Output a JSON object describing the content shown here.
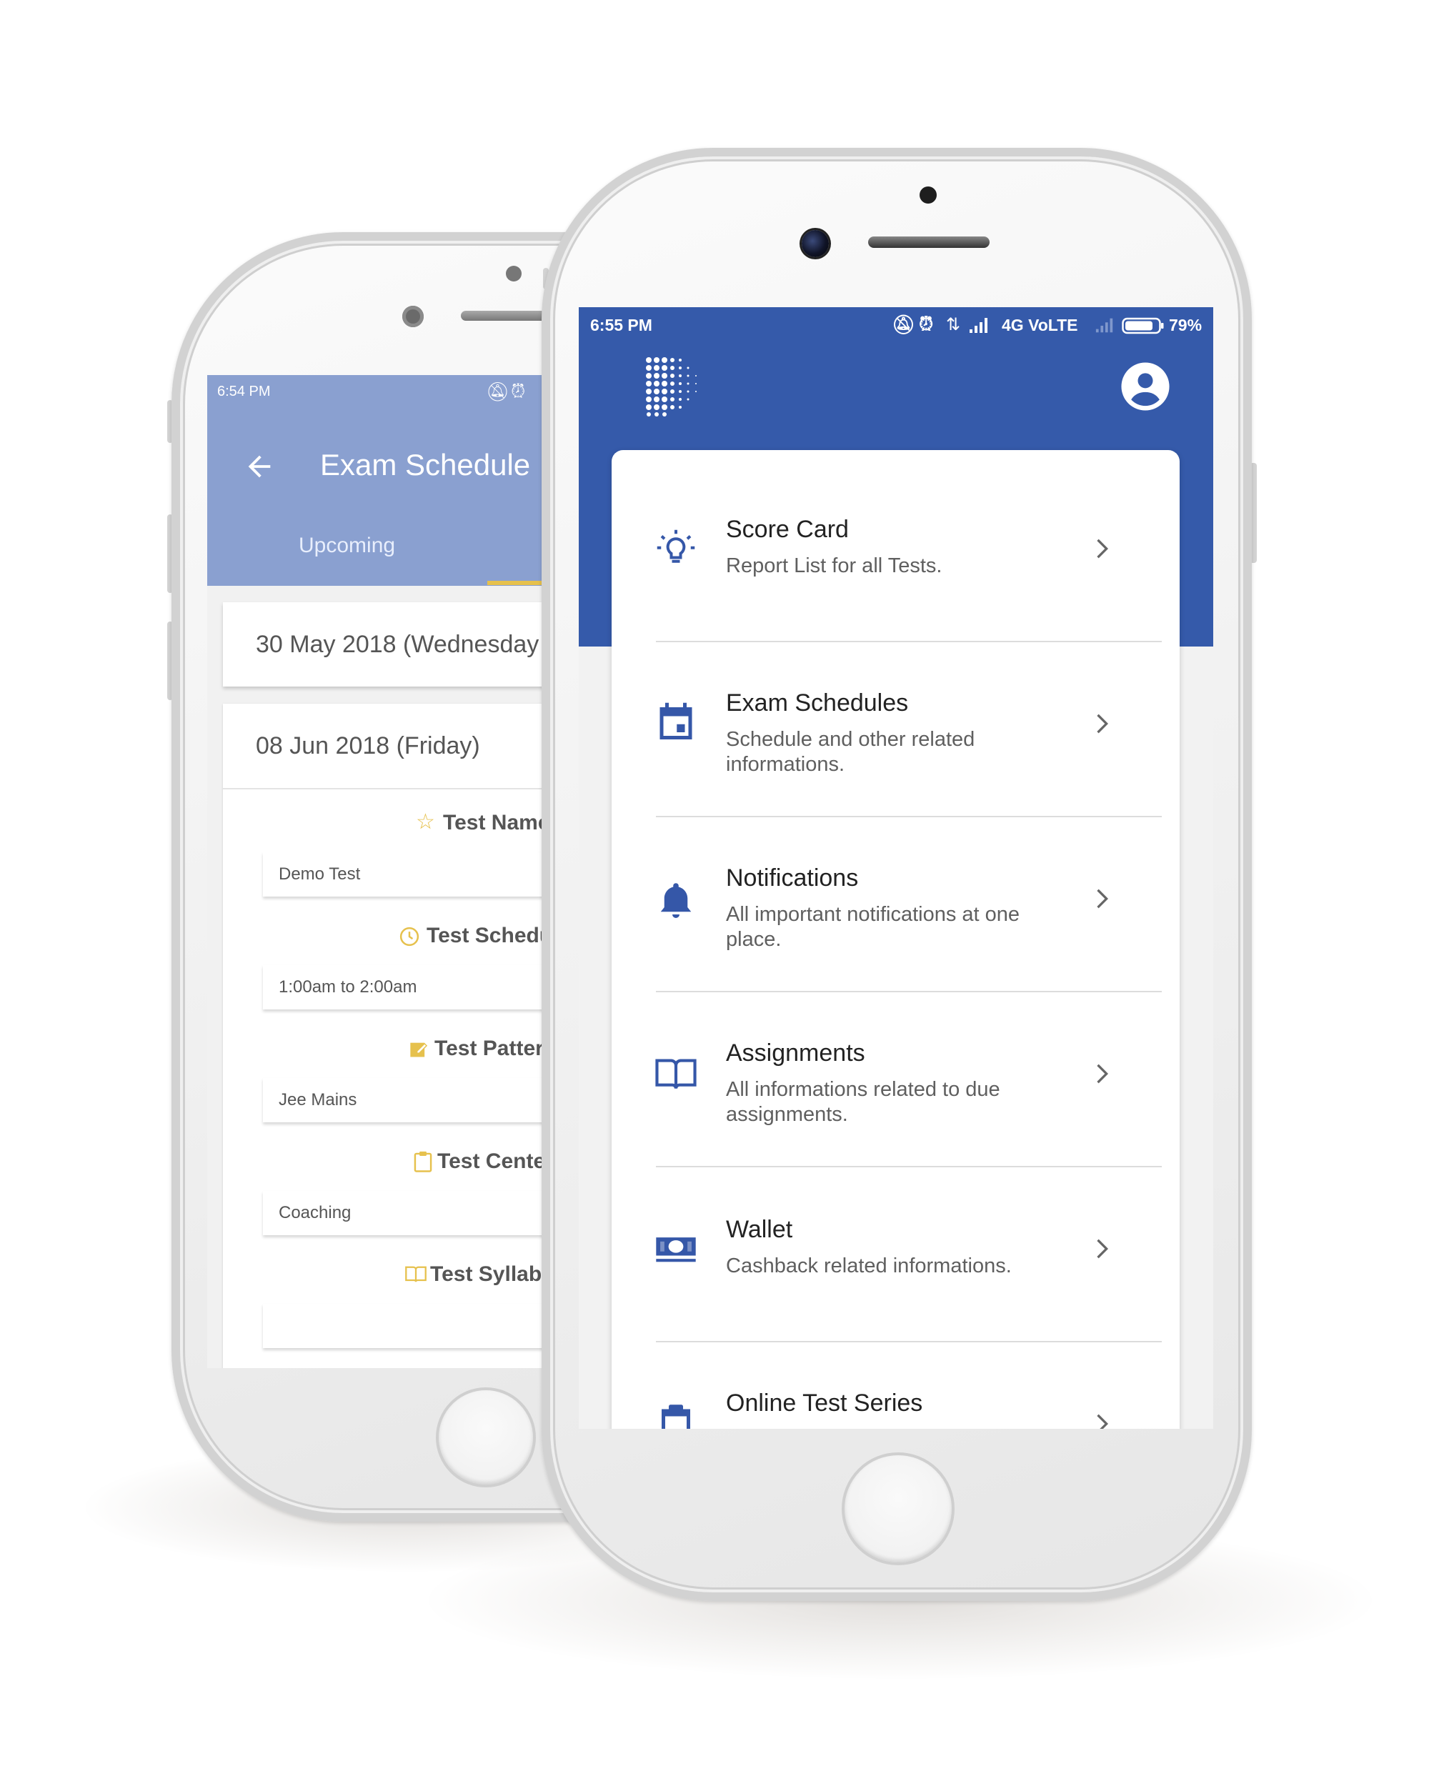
{
  "back_phone": {
    "status_time": "6:54 PM",
    "title": "Exam Schedule",
    "tab_upcoming": "Upcoming",
    "dates": [
      "30 May 2018 (Wednesday",
      "08 Jun 2018 (Friday)"
    ],
    "fields": [
      {
        "icon": "star-icon",
        "label": "Test Name",
        "value": "Demo Test"
      },
      {
        "icon": "clock-icon",
        "label": "Test Schedu",
        "value": "1:00am to 2:00am"
      },
      {
        "icon": "edit-icon",
        "label": "Test Patter",
        "value": "Jee Mains"
      },
      {
        "icon": "clipboard-icon",
        "label": "Test Cente",
        "value": "Coaching"
      },
      {
        "icon": "book-icon",
        "label": "Test Syllabu",
        "value": ""
      }
    ],
    "colors": {
      "appbar": "#8aa0d0",
      "accent": "#e6c14d"
    }
  },
  "front_phone": {
    "status_time": "6:55 PM",
    "status_network": "4G VoLTE",
    "status_battery": "79%",
    "menu": [
      {
        "icon": "lightbulb-icon",
        "title": "Score Card",
        "subtitle": "Report List for all Tests."
      },
      {
        "icon": "calendar-icon",
        "title": "Exam Schedules",
        "subtitle": "Schedule and other related informations."
      },
      {
        "icon": "bell-icon",
        "title": "Notifications",
        "subtitle": "All important notifications at one place."
      },
      {
        "icon": "book-open-icon",
        "title": "Assignments",
        "subtitle": "All informations related to due assignments."
      },
      {
        "icon": "money-icon",
        "title": "Wallet",
        "subtitle": "Cashback related informations."
      },
      {
        "icon": "clipboard-icon",
        "title": "Online Test Series",
        "subtitle": ""
      }
    ],
    "colors": {
      "header": "#355aaa",
      "icon": "#3557a8"
    }
  }
}
